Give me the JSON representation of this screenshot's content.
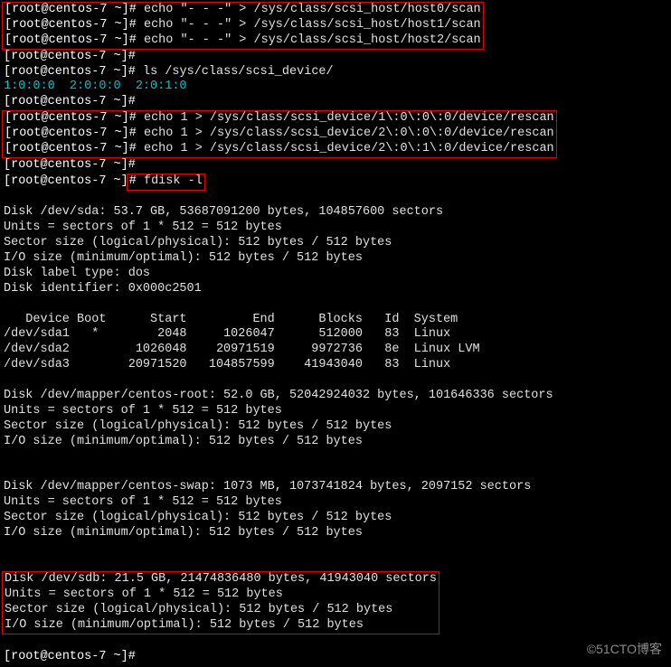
{
  "prompt": {
    "user": "root",
    "at": "@",
    "host": "centos-7",
    "path": "~",
    "hash": "#"
  },
  "commands": {
    "echo_host0": "echo \"- - -\" > /sys/class/scsi_host/host0/scan",
    "echo_host1": "echo \"- - -\" > /sys/class/scsi_host/host1/scan",
    "echo_host2": "echo \"- - -\" > /sys/class/scsi_host/host2/scan",
    "ls_scsi_dev": "ls /sys/class/scsi_device/",
    "rescan0": "echo 1 > /sys/class/scsi_device/1\\:0\\:0\\:0/device/rescan",
    "rescan1": "echo 1 > /sys/class/scsi_device/2\\:0\\:0\\:0/device/rescan",
    "rescan2": "echo 1 > /sys/class/scsi_device/2\\:0\\:1\\:0/device/rescan",
    "fdisk": "fdisk -l"
  },
  "ls_output": "1:0:0:0  2:0:0:0  2:0:1:0",
  "fdisk_out": {
    "sda_header": "Disk /dev/sda: 53.7 GB, 53687091200 bytes, 104857600 sectors",
    "units": "Units = sectors of 1 * 512 = 512 bytes",
    "sector": "Sector size (logical/physical): 512 bytes / 512 bytes",
    "io": "I/O size (minimum/optimal): 512 bytes / 512 bytes",
    "label": "Disk label type: dos",
    "ident": "Disk identifier: 0x000c2501",
    "part_header": "   Device Boot      Start         End      Blocks   Id  System",
    "part1": "/dev/sda1   *        2048     1026047      512000   83  Linux",
    "part2": "/dev/sda2         1026048    20971519     9972736   8e  Linux LVM",
    "part3": "/dev/sda3        20971520   104857599    41943040   83  Linux",
    "root_header": "Disk /dev/mapper/centos-root: 52.0 GB, 52042924032 bytes, 101646336 sectors",
    "swap_header": "Disk /dev/mapper/centos-swap: 1073 MB, 1073741824 bytes, 2097152 sectors",
    "sdb_header": "Disk /dev/sdb: 21.5 GB, 21474836480 bytes, 41943040 sectors"
  },
  "watermark": "©51CTO博客"
}
